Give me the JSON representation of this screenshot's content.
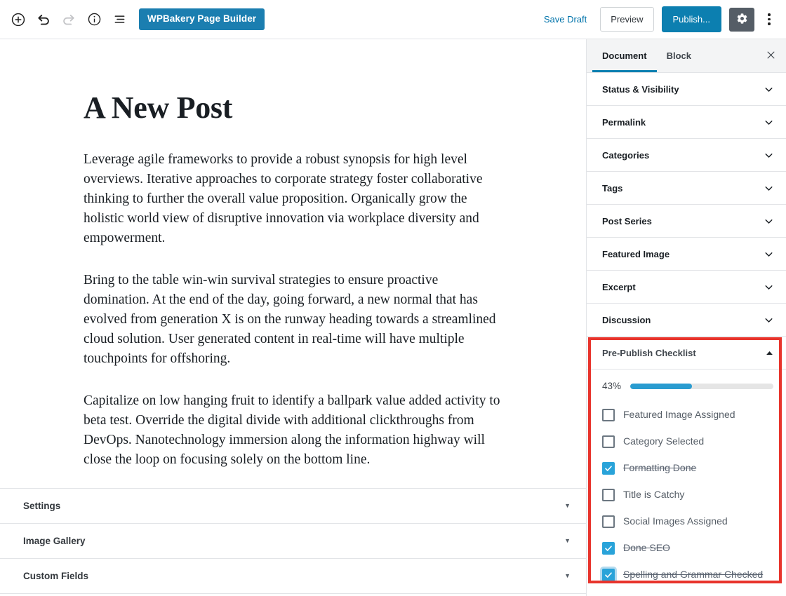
{
  "toolbar": {
    "left_icons": [
      {
        "name": "add-block-icon",
        "label": "Add block"
      },
      {
        "name": "undo-icon",
        "label": "Undo"
      },
      {
        "name": "redo-icon",
        "label": "Redo"
      },
      {
        "name": "content-info-icon",
        "label": "Content structure"
      },
      {
        "name": "block-navigation-icon",
        "label": "Block navigation"
      }
    ],
    "page_builder_label": "WPBakery Page Builder",
    "save_draft_label": "Save Draft",
    "preview_label": "Preview",
    "publish_label": "Publish...",
    "settings_gear_label": "Settings",
    "more_options_label": "More tools & options",
    "accent_blue": "#0c7fb0",
    "page_builder_blue": "#1b7eb0",
    "gear_gray": "#555d66",
    "save_draft_link_color": "#0073aa"
  },
  "editor": {
    "title": "A New Post",
    "paragraphs": [
      "Leverage agile frameworks to provide a robust synopsis for high level overviews. Iterative approaches to corporate strategy foster collaborative thinking to further the overall value proposition. Organically grow the holistic world view of disruptive innovation via workplace diversity and empowerment.",
      "Bring to the table win-win survival strategies to ensure proactive domination. At the end of the day, going forward, a new normal that has evolved from generation X is on the runway heading towards a streamlined cloud solution. User generated content in real-time will have multiple touchpoints for offshoring.",
      "Capitalize on low hanging fruit to identify a ballpark value added activity to beta test. Override the digital divide with additional clickthroughs from DevOps. Nanotechnology immersion along the information highway will close the loop on focusing solely on the bottom line."
    ]
  },
  "metaboxes": {
    "toggle_glyph": "▼",
    "items": [
      {
        "title": "Settings"
      },
      {
        "title": "Image Gallery"
      },
      {
        "title": "Custom Fields"
      }
    ]
  },
  "sidebar": {
    "tabs": [
      {
        "label": "Document",
        "active": true
      },
      {
        "label": "Block",
        "active": false
      }
    ],
    "close_label": "Close settings",
    "panels": [
      {
        "title": "Status & Visibility"
      },
      {
        "title": "Permalink"
      },
      {
        "title": "Categories"
      },
      {
        "title": "Tags"
      },
      {
        "title": "Post Series"
      },
      {
        "title": "Featured Image"
      },
      {
        "title": "Excerpt"
      },
      {
        "title": "Discussion"
      }
    ],
    "checklist": {
      "title": "Pre-Publish Checklist",
      "expanded": true,
      "highlight_color": "#e8342c",
      "progress_percent_label": "43%",
      "progress_percent_value": 43,
      "progress_fill_color": "#2a9cd0",
      "checkbox_checked_color": "#29a3d9",
      "items": [
        {
          "label": "Featured Image Assigned",
          "checked": false,
          "focused": false
        },
        {
          "label": "Category Selected",
          "checked": false,
          "focused": false
        },
        {
          "label": "Formatting Done",
          "checked": true,
          "focused": false
        },
        {
          "label": "Title is Catchy",
          "checked": false,
          "focused": false
        },
        {
          "label": "Social Images Assigned",
          "checked": false,
          "focused": false
        },
        {
          "label": "Done SEO",
          "checked": true,
          "focused": false
        },
        {
          "label": "Spelling and Grammar Checked",
          "checked": true,
          "focused": true
        }
      ]
    }
  }
}
